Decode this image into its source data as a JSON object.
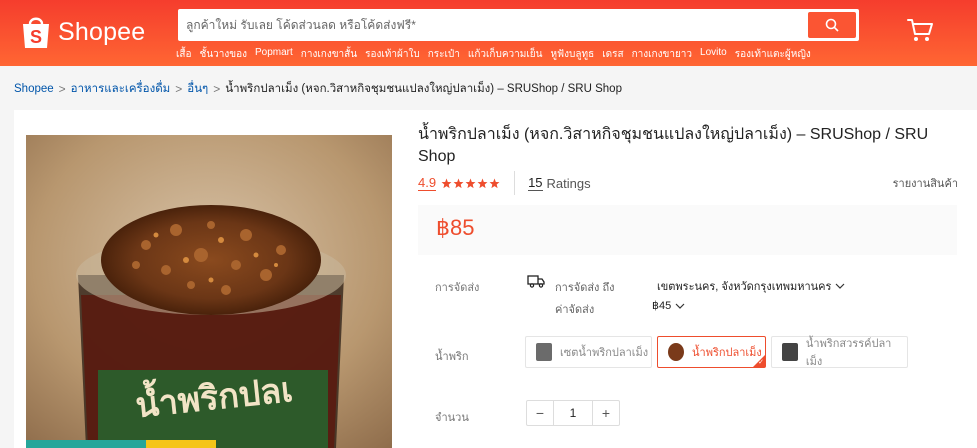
{
  "header": {
    "brand": "Shopee",
    "search_placeholder": "ลูกค้าใหม่ รับเลย โค้ดส่วนลด หรือโค้ดส่งฟรี*",
    "quick_links": [
      "เสื้อ",
      "ชั้นวางของ",
      "Popmart",
      "กางเกงขาสั้น",
      "รองเท้าผ้าใบ",
      "กระเป๋า",
      "แก้วเก็บความเย็น",
      "หูฟังบลูทูธ",
      "เดรส",
      "กางเกงขายาว",
      "Lovito",
      "รองเท้าแตะผู้หญิง"
    ]
  },
  "breadcrumb": {
    "items": [
      "Shopee",
      "อาหารและเครื่องดื่ม",
      "อื่นๆ"
    ],
    "current": "น้ำพริกปลาเม็ง (หจก.วิสาหกิจชุมชนแปลงใหญ่ปลาเม็ง) – SRUShop / SRU Shop"
  },
  "product": {
    "title": "น้ำพริกปลาเม็ง (หจก.วิสาหกิจชุมชนแปลงใหญ่ปลาเม็ง) – SRUShop / SRU Shop",
    "rating": "4.9",
    "stars": 5,
    "ratings_count": "15",
    "ratings_label": "Ratings",
    "report_label": "รายงานสินค้า",
    "price": "฿85"
  },
  "shipping": {
    "label": "การจัดส่ง",
    "ship_to_label": "การจัดส่ง ถึง",
    "ship_to_value": "เขตพระนคร, จังหวัดกรุงเทพมหานคร",
    "fee_label": "ค่าจัดส่ง",
    "fee_value": "฿45"
  },
  "variants": {
    "label": "น้ำพริก",
    "options": [
      "เซตน้ำพริกปลาเม็ง",
      "น้ำพริกปลาเม็ง",
      "น้ำพริกสวรรค์ปลาเม็ง"
    ],
    "selected": "น้ำพริกปลาเม็ง"
  },
  "quantity": {
    "label": "จำนวน",
    "value": "1",
    "minus": "−",
    "plus": "+"
  },
  "colors": {
    "brand": "#ee4d2d",
    "link": "#0055aa"
  }
}
